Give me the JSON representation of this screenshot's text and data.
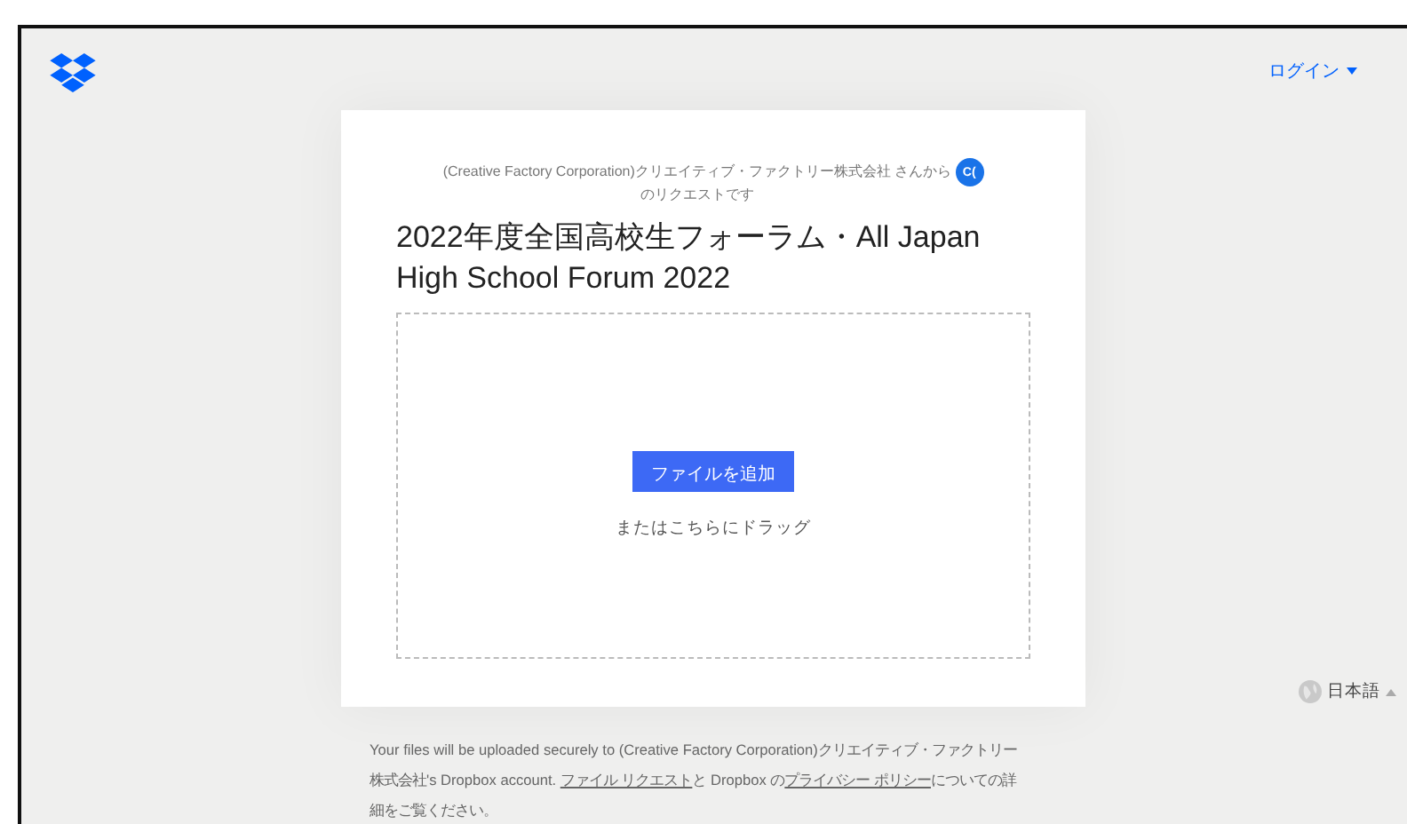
{
  "header": {
    "login": {
      "label": "ログイン"
    }
  },
  "request": {
    "requester": "(Creative Factory Corporation)クリエイティブ・ファクトリー株式会社 さんから",
    "requester_suffix": "のリクエストです",
    "avatar": "C(",
    "title": "2022年度全国高校生フォーラム・All Japan High School Forum 2022"
  },
  "dropzone": {
    "button": "ファイルを追加",
    "hint": "またはこちらにドラッグ"
  },
  "language": {
    "label": "日本語"
  },
  "footer": {
    "text_1": "Your files will be uploaded securely to (Creative Factory Corporation)クリエイティブ・ファクトリー株式会社's Dropbox account. ",
    "link_1": "ファイル リクエスト",
    "text_2": "と Dropbox の",
    "link_2": "プライバシー ポリシー",
    "text_3": "についての詳細をご覧ください。"
  }
}
